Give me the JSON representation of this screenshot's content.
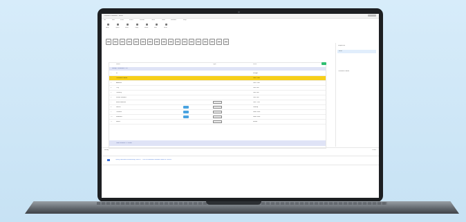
{
  "app": {
    "title": "Customer Database - Editor",
    "menu": [
      "File",
      "Edit",
      "View",
      "Insert",
      "Format",
      "Tools",
      "Data",
      "Window",
      "Help"
    ]
  },
  "toolbar": {
    "buttons": [
      "New",
      "Open",
      "Save",
      "Copy",
      "Paste",
      "Run",
      "Filter"
    ]
  },
  "grid": {
    "columns": [
      "Name",
      "",
      "Type",
      "Value"
    ],
    "header_bar": "Group: Customers (11)",
    "rows": [
      {
        "n": "1",
        "name": "ID",
        "val": "Integer"
      },
      {
        "n": "2",
        "name": "Customer Name",
        "val": "Text (255)"
      },
      {
        "n": "3",
        "name": "Address",
        "val": "Text (255)"
      },
      {
        "n": "4",
        "name": "City",
        "val": "Text (80)"
      },
      {
        "n": "5",
        "name": "Country",
        "val": "Text (80)"
      },
      {
        "n": "6",
        "name": "Phone number",
        "val": "Text (40)"
      },
      {
        "n": "7",
        "name": "Email address",
        "val": "Text (120)"
      },
      {
        "n": "8",
        "name": "Status",
        "val": "Lookup"
      },
      {
        "n": "9",
        "name": "Created",
        "val": "Date/Time"
      },
      {
        "n": "10",
        "name": "Modified",
        "val": "Date/Time"
      },
      {
        "n": "11",
        "name": "Notes",
        "val": "Memo"
      }
    ],
    "summary": "Total records: 11 fields"
  },
  "right_panel": {
    "title": "Properties",
    "selected": "Field",
    "label": "Customer Name"
  },
  "status": {
    "left": "Ready",
    "right": "100%"
  },
  "console": {
    "message": "Query executed successfully: SELECT * FROM customers WHERE status = 'active'"
  },
  "colors": {
    "selected_row": "#f7cf1a",
    "accent": "#4aa3e0",
    "success": "#2fbf71"
  }
}
